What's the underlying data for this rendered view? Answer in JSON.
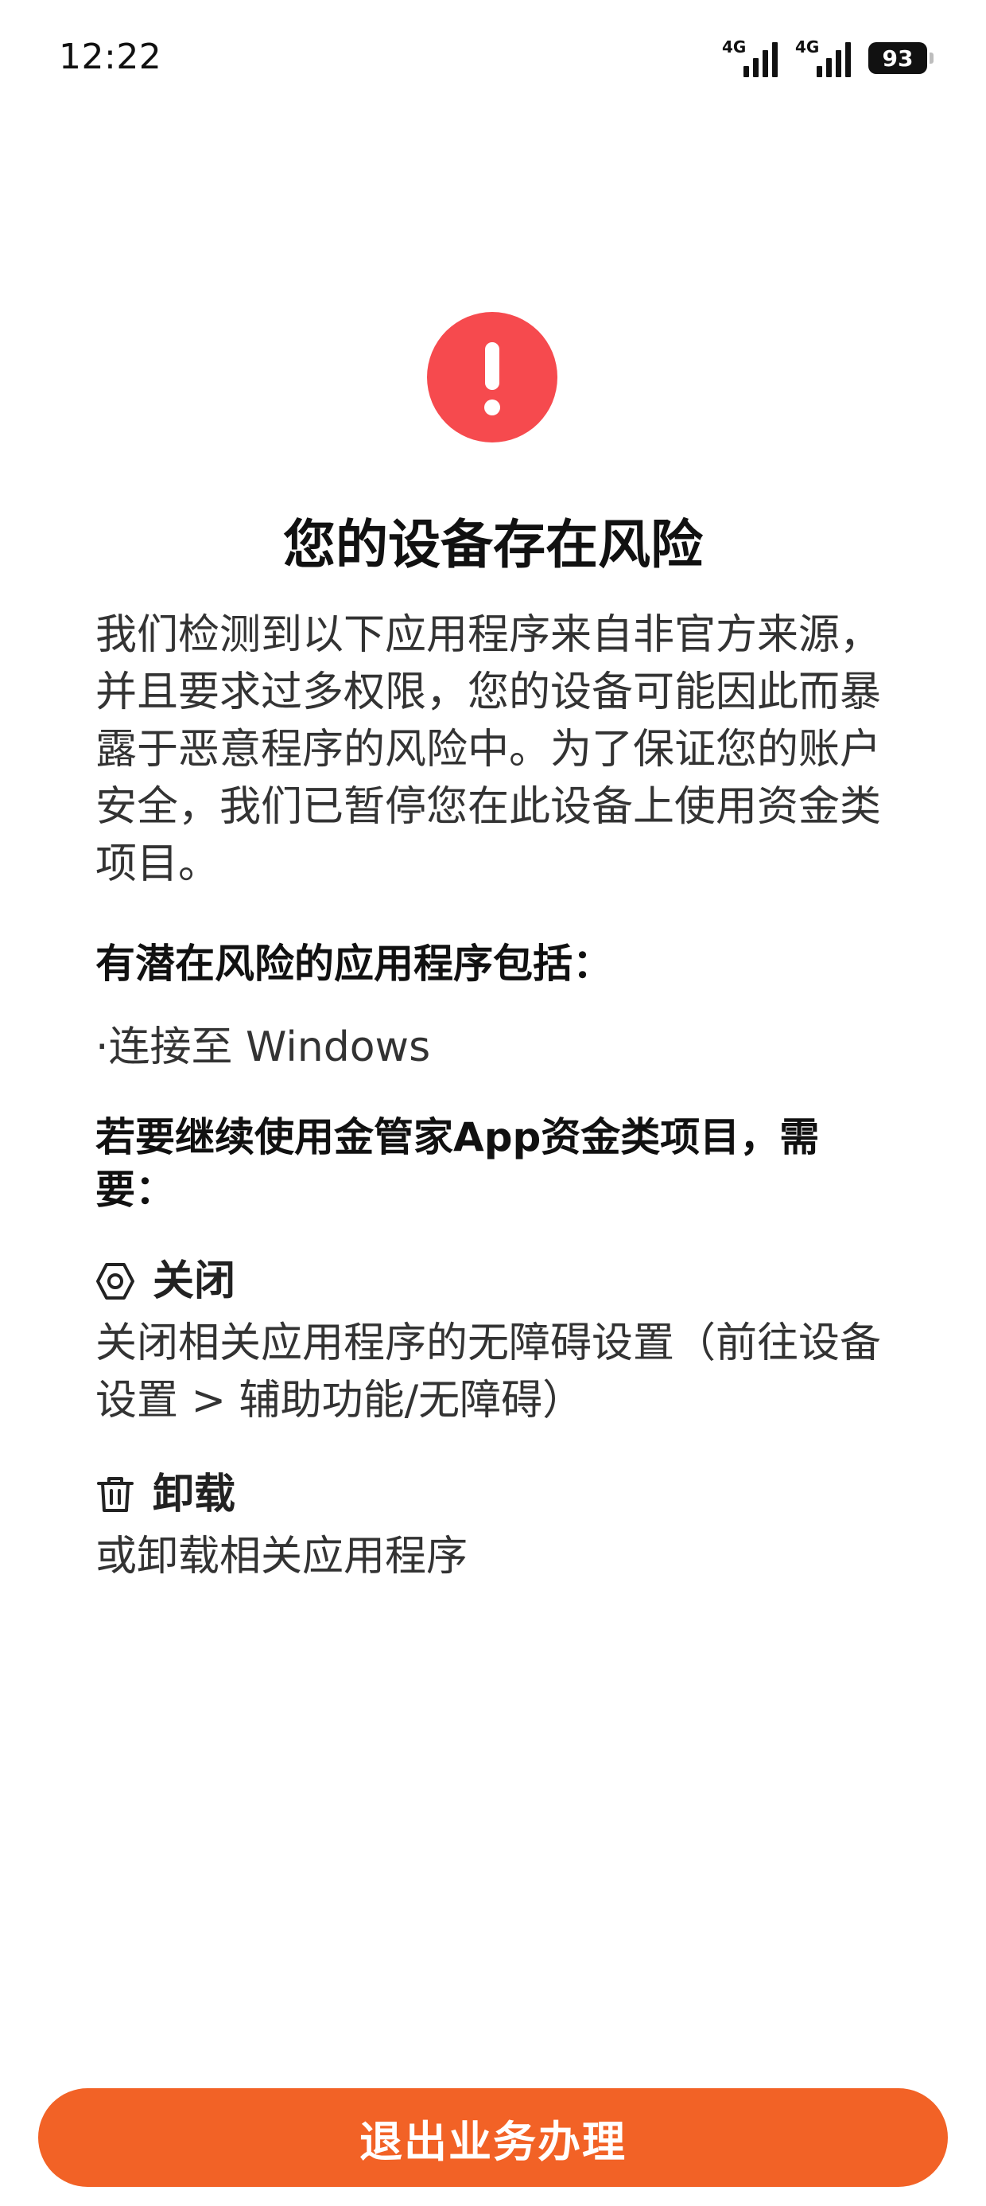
{
  "status_bar": {
    "time": "12:22",
    "signal1_label": "4G",
    "signal2_label": "4G",
    "battery": "93"
  },
  "colors": {
    "warning": "#f64a4e",
    "button": "#f26226"
  },
  "icons": {
    "warning": "exclamation-circle-icon",
    "close": "hexagon-settings-icon",
    "uninstall": "trash-icon"
  },
  "main": {
    "title": "您的设备存在风险",
    "description": "我们检测到以下应用程序来自非官方来源，并且要求过多权限，您的设备可能因此而暴露于恶意程序的风险中。为了保证您的账户安全，我们已暂停您在此设备上使用资金类项目。",
    "apps_heading": "有潜在风险的应用程序包括：",
    "apps": [
      "·连接至 Windows"
    ],
    "requirements_heading": "若要继续使用金管家App资金类项目，需要：",
    "steps": [
      {
        "title": "关闭",
        "desc": "关闭相关应用程序的无障碍设置（前往设备设置 > 辅助功能/无障碍）"
      },
      {
        "title": "卸载",
        "desc": "或卸载相关应用程序"
      }
    ]
  },
  "footer": {
    "exit_label": "退出业务办理"
  }
}
